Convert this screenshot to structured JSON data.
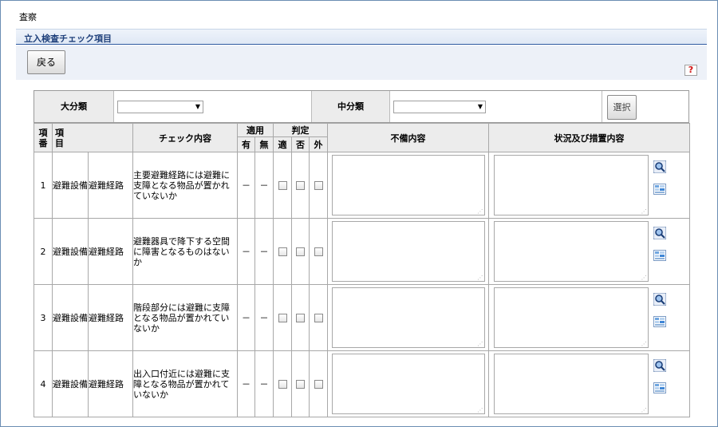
{
  "page": {
    "heading": "査察"
  },
  "section": {
    "title": "立入検査チェック項目"
  },
  "toolbar": {
    "back_label": "戻る",
    "help_label": "?"
  },
  "filter": {
    "major_label": "大分類",
    "major_value": "",
    "middle_label": "中分類",
    "middle_value": "",
    "select_label": "選択"
  },
  "table": {
    "headers": {
      "number": "項番",
      "item": "項目",
      "check_content": "チェック内容",
      "applicable": "適用",
      "applicable_yes": "有",
      "applicable_no": "無",
      "judgement": "判定",
      "judge_ok": "適",
      "judge_ng": "否",
      "judge_out": "外",
      "deficiency": "不備内容",
      "status_action": "状況及び措置内容"
    },
    "rows": [
      {
        "no": "1",
        "category": "避難設備",
        "subcategory": "避難経路",
        "content": "主要避難経路には避難に支障となる物品が置かれていないか",
        "yes": "－",
        "no_mark": "－"
      },
      {
        "no": "2",
        "category": "避難設備",
        "subcategory": "避難経路",
        "content": "避難器具で降下する空間に障害となるものはないか",
        "yes": "－",
        "no_mark": "－"
      },
      {
        "no": "3",
        "category": "避難設備",
        "subcategory": "避難経路",
        "content": "階段部分には避難に支障となる物品が置かれていないか",
        "yes": "－",
        "no_mark": "－"
      },
      {
        "no": "4",
        "category": "避難設備",
        "subcategory": "避難経路",
        "content": "出入口付近には避難に支障となる物品が置かれていないか",
        "yes": "－",
        "no_mark": "－"
      }
    ]
  },
  "icons": {
    "search": "magnifier-icon",
    "sheet": "sheet-icon"
  }
}
